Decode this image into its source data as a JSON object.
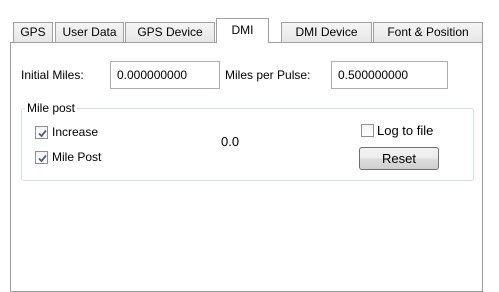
{
  "tabs": [
    "GPS",
    "User Data",
    "GPS Device",
    "DMI",
    "DMI Device",
    "Font & Position"
  ],
  "active_tab": "DMI",
  "fields": {
    "initial_miles_label": "Initial Miles:",
    "initial_miles_value": "0.000000000",
    "miles_per_pulse_label": "Miles per Pulse:",
    "miles_per_pulse_value": "0.500000000"
  },
  "mile_post": {
    "title": "Mile post",
    "increase_label": "Increase",
    "increase_checked": true,
    "mile_post_label": "Mile Post",
    "mile_post_checked": true,
    "value": "0.0",
    "log_to_file_label": "Log to file",
    "log_to_file_checked": false,
    "reset_label": "Reset"
  },
  "colors": {
    "check_mark": "#4a5f97",
    "tab_border": "#a0a0a0",
    "group_border": "#d5dfe5"
  }
}
